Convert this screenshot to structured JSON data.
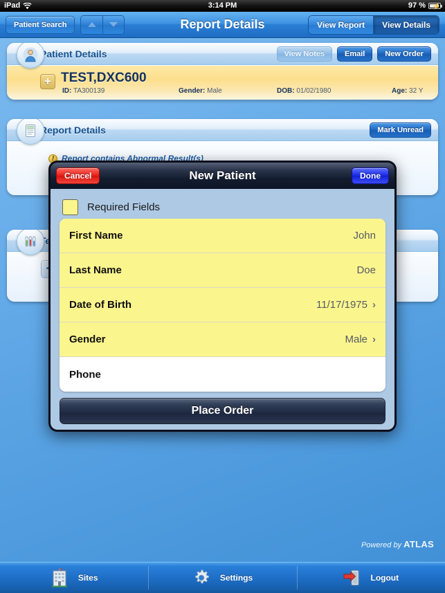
{
  "status_bar": {
    "device": "iPad",
    "wifi_icon": "wifi-icon",
    "time": "3:14 PM",
    "battery_percent": "97 %",
    "battery_icon": "battery-charging-icon"
  },
  "navbar": {
    "patient_search": "Patient Search",
    "nav_up_icon": "chevron-up-icon",
    "nav_down_icon": "chevron-down-icon",
    "title": "Report Details",
    "segments": [
      {
        "label": "View Report",
        "selected": false
      },
      {
        "label": "View Details",
        "selected": true
      }
    ]
  },
  "patient_panel": {
    "icon": "patient-avatar-icon",
    "title": "Patient Details",
    "actions": [
      {
        "label": "View Notes",
        "disabled": true
      },
      {
        "label": "Email",
        "disabled": false
      },
      {
        "label": "New Order",
        "disabled": false
      }
    ],
    "row": {
      "expand_icon": "plus-icon",
      "name": "TEST,DXC600",
      "fields": [
        {
          "label": "ID:",
          "value": "TA300139"
        },
        {
          "label": "Gender:",
          "value": "Male"
        },
        {
          "label": "DOB:",
          "value": "01/02/1980"
        },
        {
          "label": "Age:",
          "value": "32 Y"
        }
      ]
    }
  },
  "report_panel": {
    "icon": "report-document-icon",
    "title": "Report Details",
    "mark_unread": "Mark Unread",
    "abnormal_icon": "warning-icon",
    "abnormal_note": "Report contains Abnormal Result(s)"
  },
  "tests_panel": {
    "icon": "test-tubes-icon",
    "title": "Tests",
    "add_icon": "plus-icon"
  },
  "modal": {
    "cancel_label": "Cancel",
    "title": "New Patient",
    "done_label": "Done",
    "required_swatch_color": "#fbf58e",
    "required_label": "Required Fields",
    "fields": [
      {
        "label": "First Name",
        "value": "John",
        "required": true,
        "chevron": false
      },
      {
        "label": "Last Name",
        "value": "Doe",
        "required": true,
        "chevron": false
      },
      {
        "label": "Date of Birth",
        "value": "11/17/1975",
        "required": true,
        "chevron": true
      },
      {
        "label": "Gender",
        "value": "Male",
        "required": true,
        "chevron": true
      },
      {
        "label": "Phone",
        "value": "",
        "required": false,
        "chevron": false
      }
    ],
    "place_order_label": "Place Order"
  },
  "footer": {
    "powered_prefix": "Powered by ",
    "powered_brand": "ATLAS"
  },
  "tabbar": {
    "items": [
      {
        "label": "Sites",
        "icon": "building-icon"
      },
      {
        "label": "Settings",
        "icon": "gear-icon"
      },
      {
        "label": "Logout",
        "icon": "logout-door-icon"
      }
    ]
  },
  "colors": {
    "accent_blue": "#2a80d8",
    "required_yellow": "#fbf58e",
    "patient_row_gold": "#fcdf8c",
    "cancel_red": "#e8201a",
    "done_blue": "#1a2ae6"
  }
}
